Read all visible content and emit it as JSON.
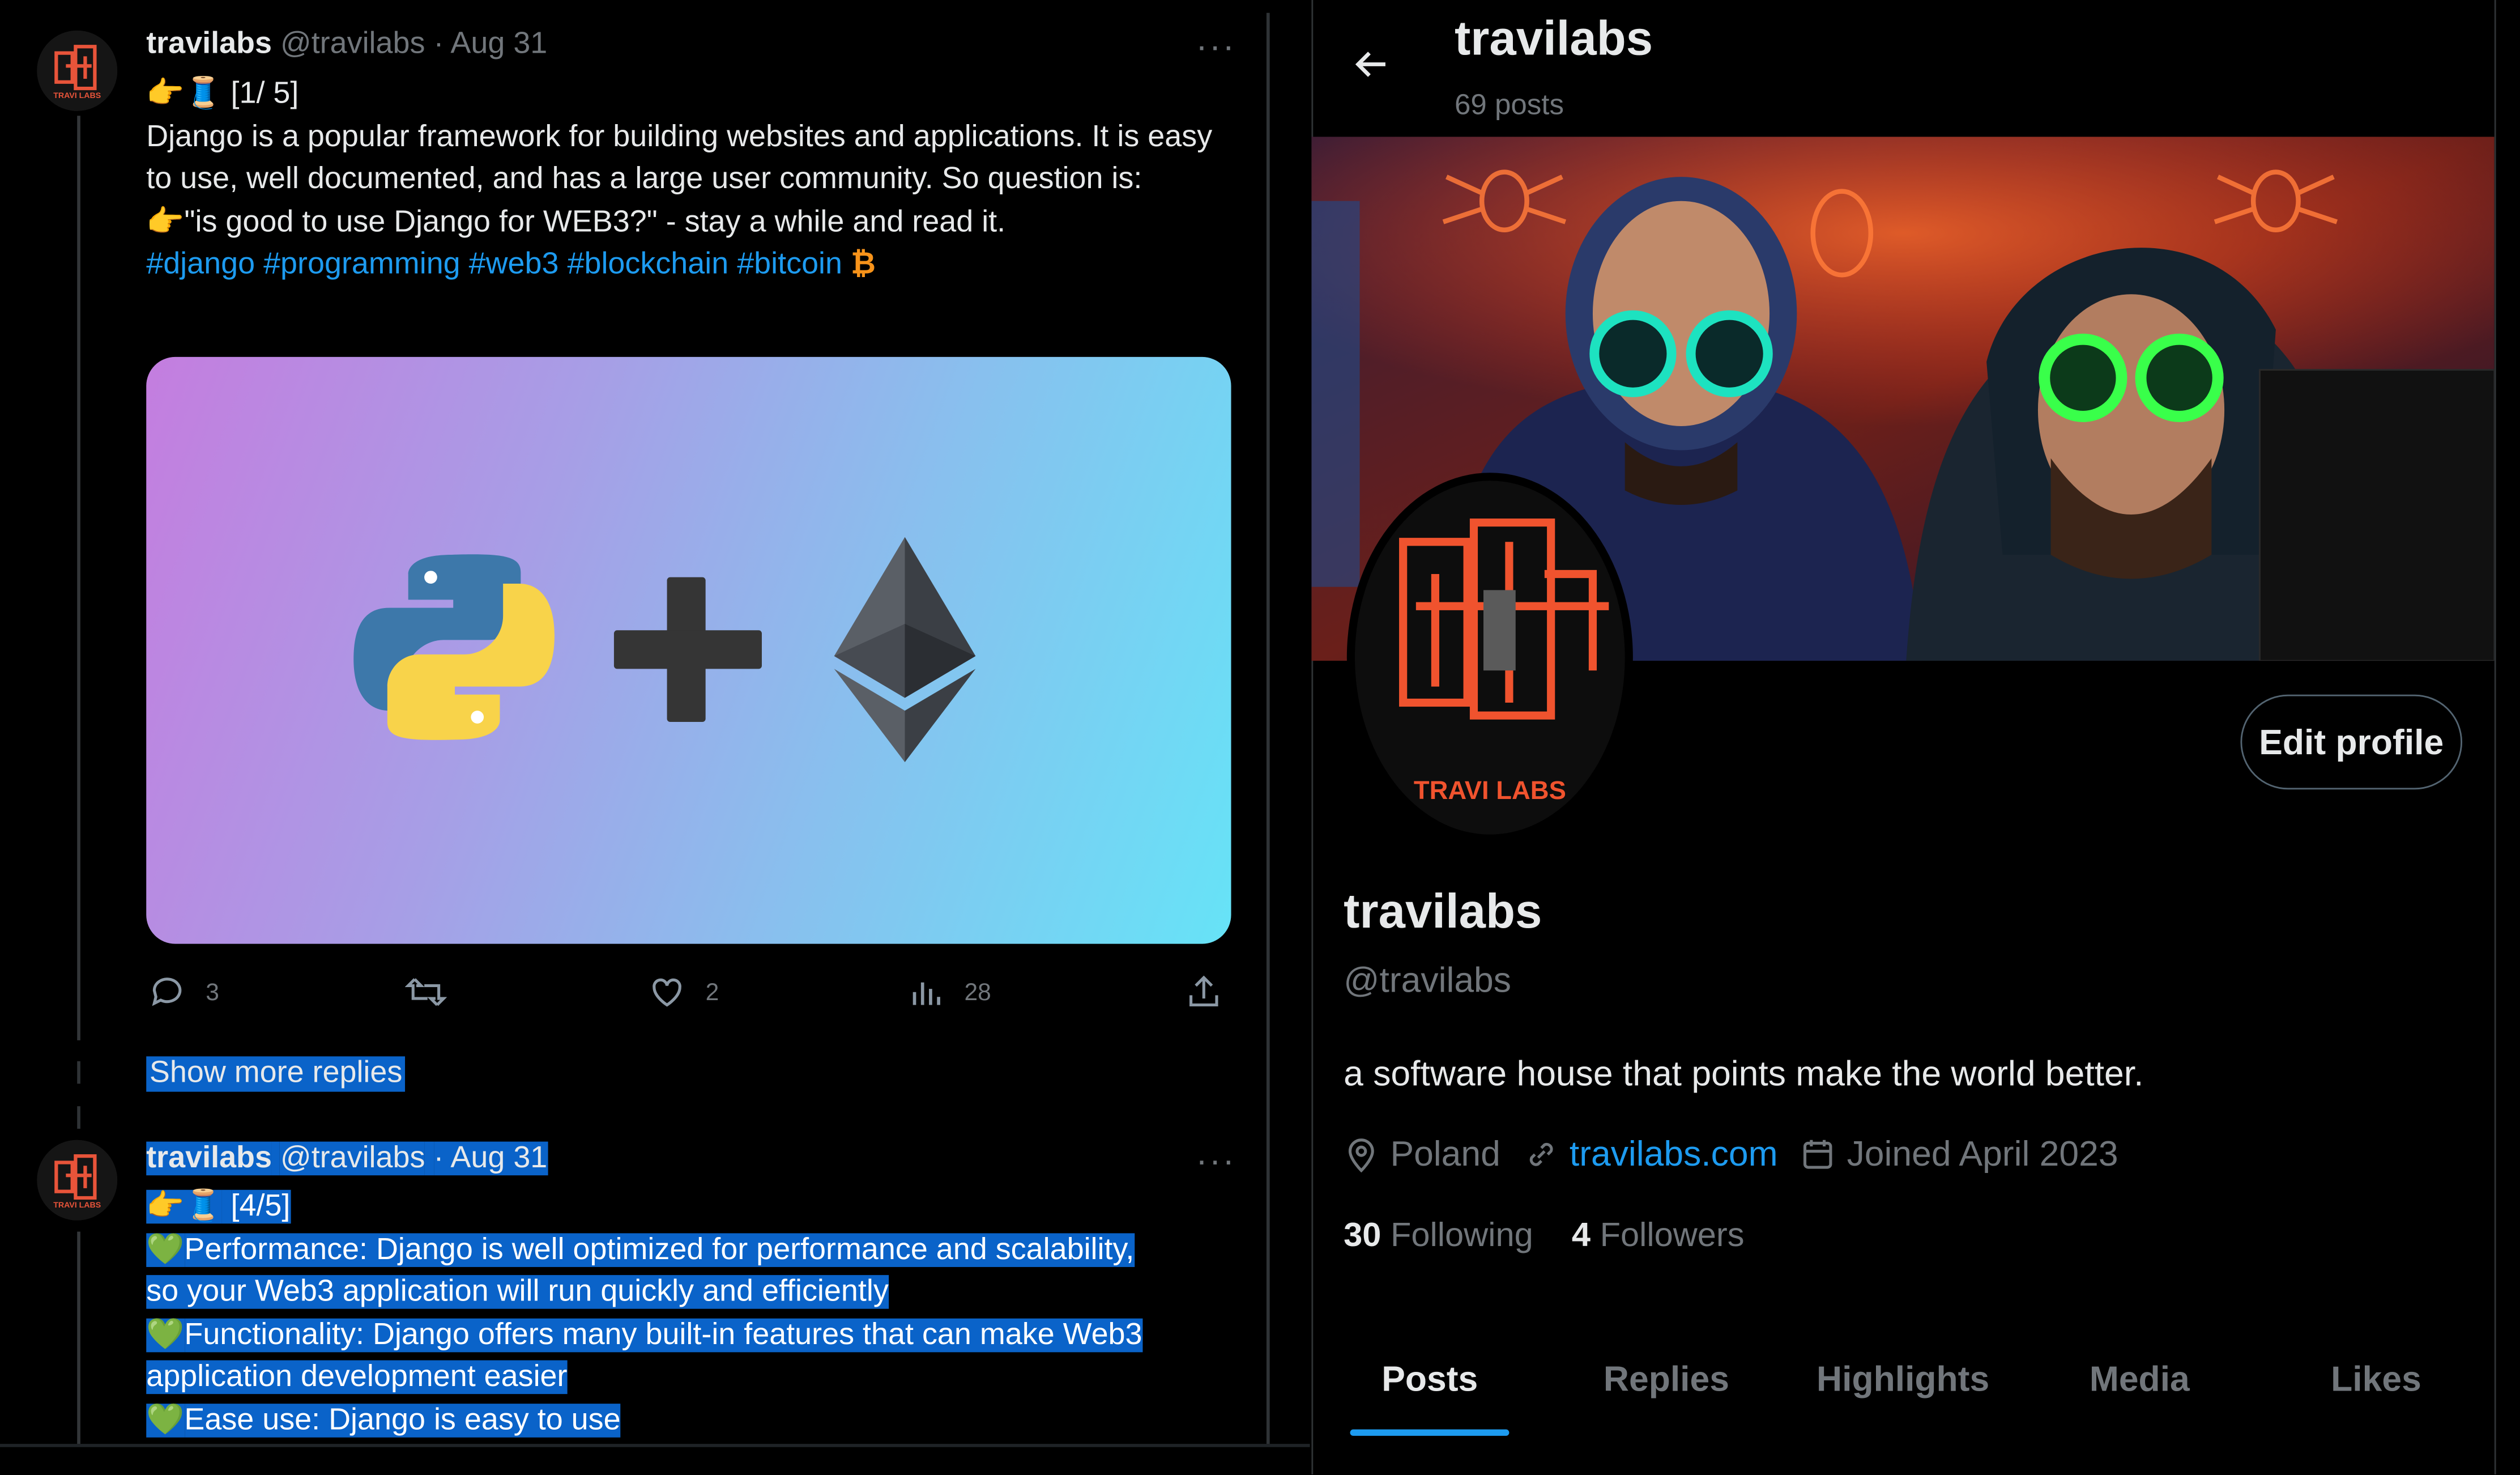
{
  "tweet1": {
    "name": "travilabs",
    "handle": "@travilabs",
    "date": "· Aug 31",
    "menu": "···",
    "line1_emoji": "👉🧵",
    "line1": "[1/ 5]",
    "body": "Django is a popular framework for building websites and applications. It is easy to use, well documented, and has a large user community. So question is:",
    "line_q_emoji": "👉",
    "line_q": "\"is good to use Django for WEB3?\" - stay a while and read it.",
    "hashtags": "#django #programming #web3 #blockchain #bitcoin",
    "hashtags_emoji": "₿",
    "replies": "3",
    "likes": "2",
    "views": "28"
  },
  "show_more": "Show more replies",
  "tweet2": {
    "name": "travilabs",
    "handle": "@travilabs",
    "date": "· Aug 31",
    "menu": "···",
    "line1_emoji": "👉🧵",
    "line1": "[4/5]",
    "items": [
      {
        "emoji": "💚",
        "text": "Performance:  Django is well optimized for performance and scalability,",
        "cont": "so your Web3 application will run quickly and efficiently"
      },
      {
        "emoji": "💚",
        "text": "Functionality: Django offers many built-in features that can make Web3",
        "cont": "application development easier"
      },
      {
        "emoji": "💚",
        "text": "Ease use: Django is easy to use",
        "cont": ""
      }
    ]
  },
  "profile": {
    "header_title": "travilabs",
    "posts_count": "69 posts",
    "avatar_text": "TRAVI LABS",
    "edit_button": "Edit profile",
    "name": "travilabs",
    "handle": "@travilabs",
    "bio": "a software house that points make the world better.",
    "location": "Poland",
    "website": "travilabs.com",
    "joined": "Joined April 2023",
    "following_count": "30",
    "following_label": "Following",
    "followers_count": "4",
    "followers_label": "Followers",
    "tabs": [
      "Posts",
      "Replies",
      "Highlights",
      "Media",
      "Likes"
    ],
    "active_tab": "Posts"
  },
  "colors": {
    "accent": "#1d9bf0",
    "muted": "#71767b",
    "selection": "#0a63c9"
  }
}
